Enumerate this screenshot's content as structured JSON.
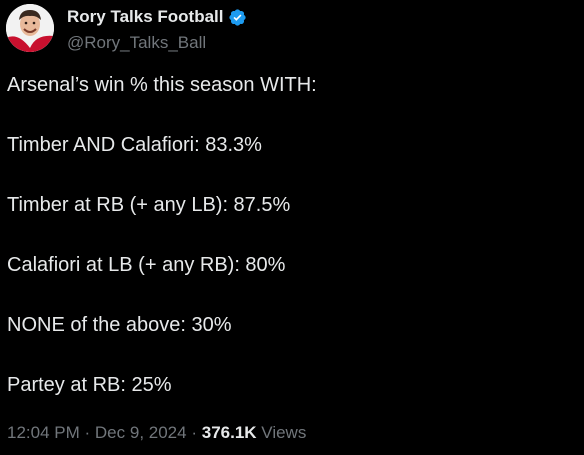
{
  "author": {
    "display_name": "Rory Talks Football",
    "handle": "@Rory_Talks_Ball",
    "verified_icon": "verified-badge-icon",
    "avatar_icon": "avatar"
  },
  "tweet": {
    "lines": [
      "Arsenal’s win % this season WITH:",
      "Timber AND Calafiori: 83.3%",
      "Timber at RB (+ any LB): 87.5%",
      "Calafiori at LB (+ any RB): 80%",
      "NONE of the above: 30%",
      "Partey at RB: 25%"
    ]
  },
  "meta": {
    "time": "12:04 PM",
    "separator": "·",
    "date": "Dec 9, 2024",
    "views_count": "376.1K",
    "views_label": "Views"
  },
  "colors": {
    "background": "#000000",
    "text": "#e7e9ea",
    "secondary": "#71767b",
    "verified": "#1d9bf0"
  }
}
